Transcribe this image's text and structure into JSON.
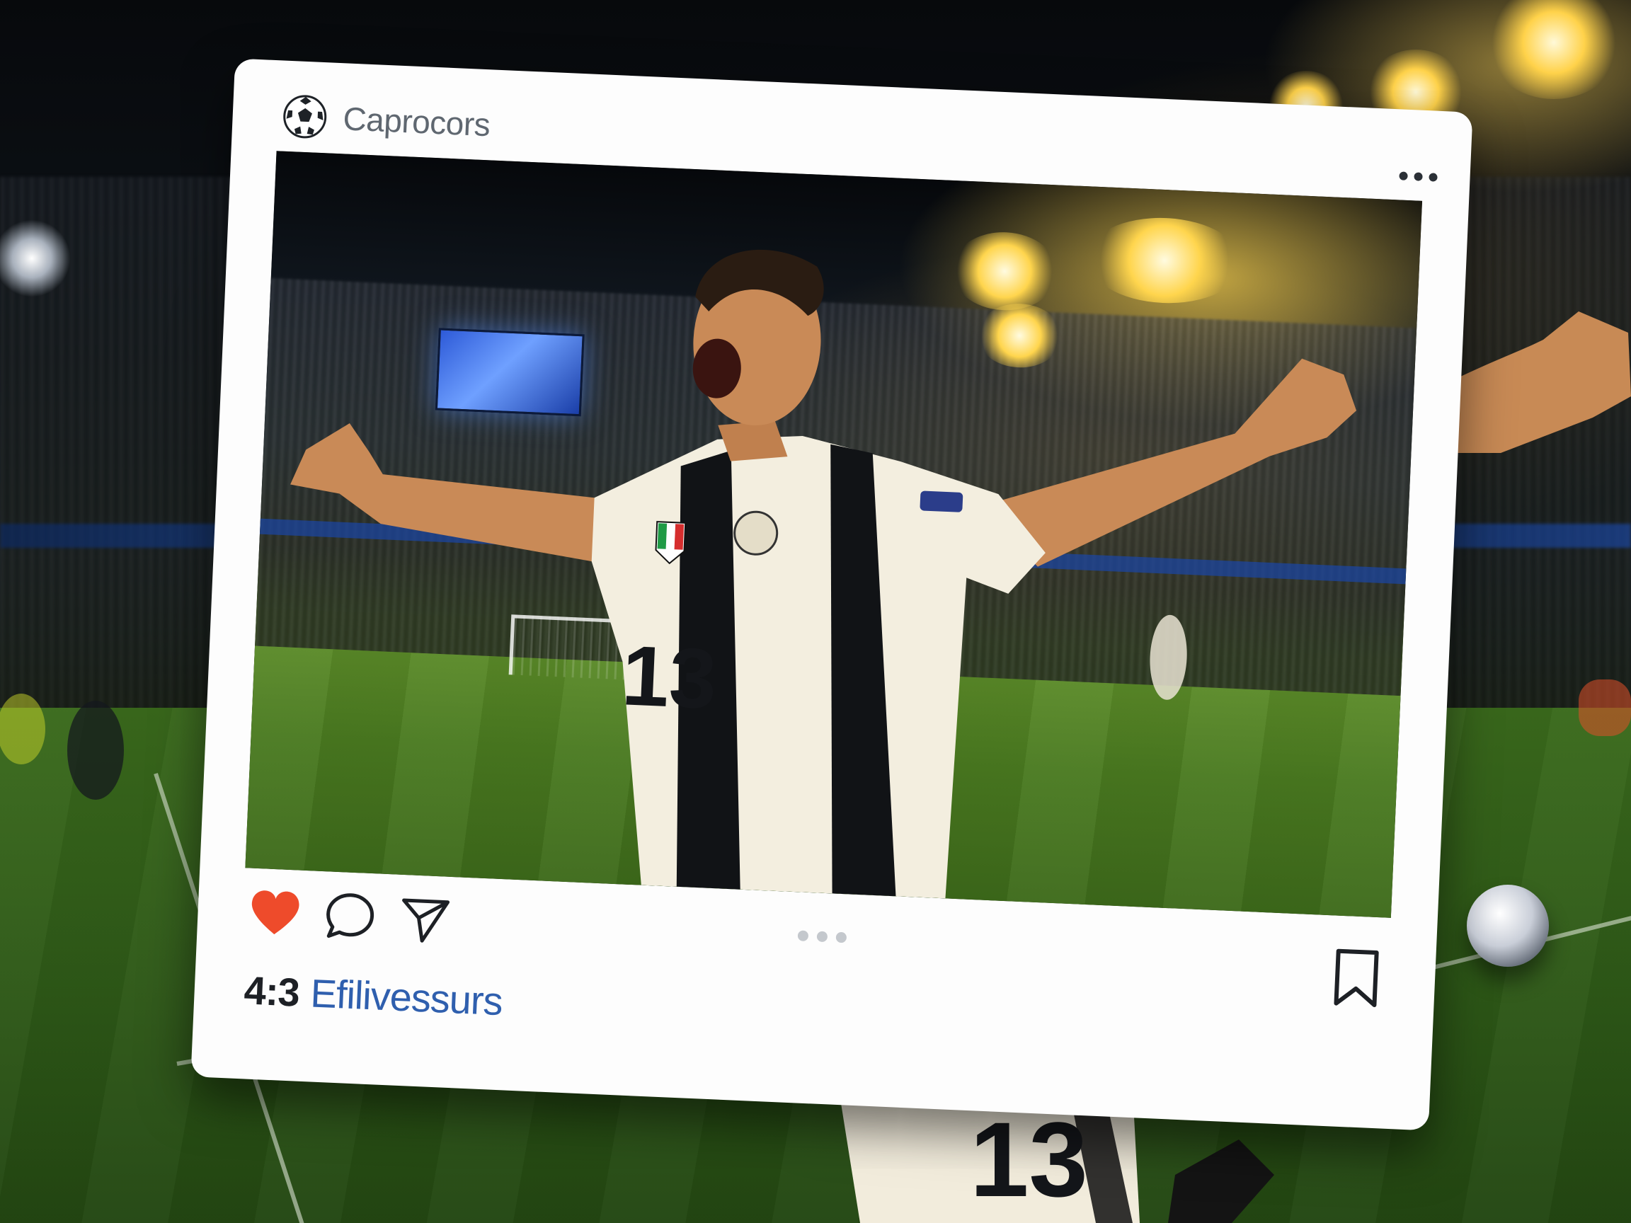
{
  "post": {
    "account_name": "Caprocors",
    "logo_icon": "soccer-ball-icon",
    "more_icon": "more-dots-icon",
    "score": "4:3",
    "handle": "Efilivessurs",
    "shirt_number": "13",
    "actions": {
      "like_icon": "heart-icon",
      "comment_icon": "comment-bubble-icon",
      "share_icon": "send-icon",
      "save_icon": "bookmark-icon"
    },
    "carousel_dots": 3
  },
  "colors": {
    "like": "#ee4b2b",
    "handle": "#2f5fae",
    "card": "#fdfdfd",
    "text_dark": "#1d2025"
  }
}
